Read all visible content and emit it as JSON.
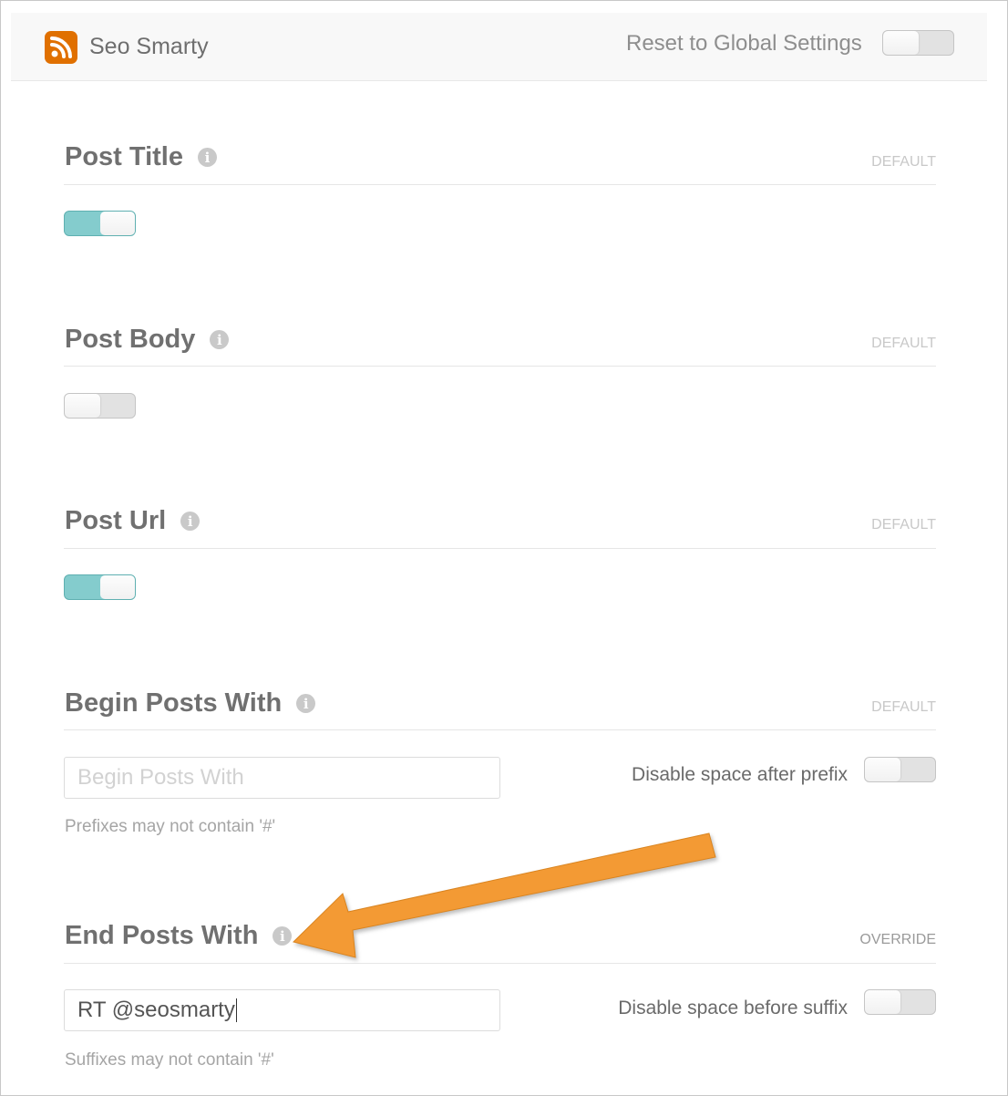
{
  "header": {
    "app_title": "Seo Smarty",
    "app_icon": "rss-icon",
    "brand_color": "#e07000",
    "reset_label": "Reset to Global Settings",
    "reset_on": false
  },
  "accent_color": "#84cccd",
  "sections": [
    {
      "title": "Post Title",
      "badge": "DEFAULT",
      "toggle_on": true
    },
    {
      "title": "Post Body",
      "badge": "DEFAULT",
      "toggle_on": false
    },
    {
      "title": "Post Url",
      "badge": "DEFAULT",
      "toggle_on": true
    }
  ],
  "begin": {
    "title": "Begin Posts With",
    "badge": "DEFAULT",
    "value": "",
    "placeholder": "Begin Posts With",
    "hint": "Prefixes may not contain '#'",
    "toggle_label": "Disable space after prefix",
    "toggle_on": false
  },
  "end": {
    "title": "End Posts With",
    "badge": "OVERRIDE",
    "value": "RT @seosmarty",
    "hint": "Suffixes may not contain '#'",
    "toggle_label": "Disable space before suffix",
    "toggle_on": false
  },
  "annotation": {
    "arrow_color": "#f39a34"
  }
}
